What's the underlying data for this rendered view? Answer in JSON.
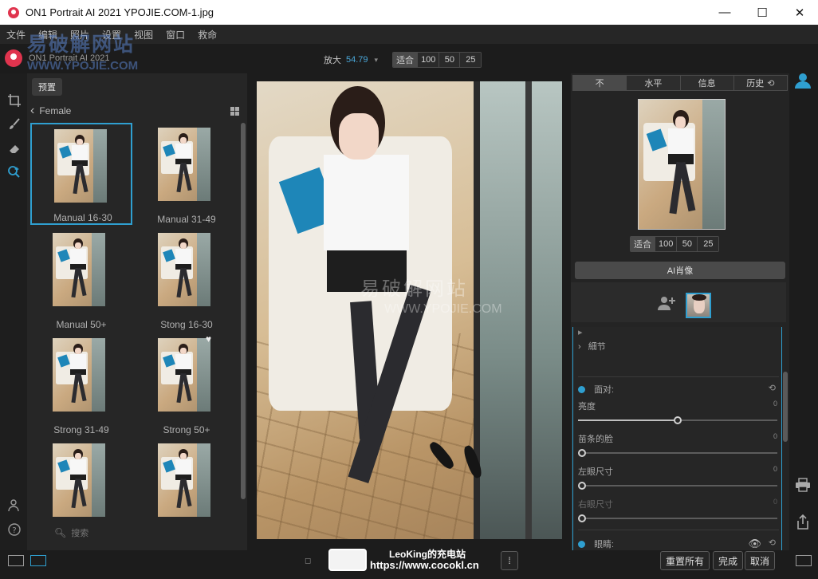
{
  "window": {
    "title": "ON1 Portrait AI 2021   YPOJIE.COM-1.jpg",
    "minimize": "—",
    "maximize": "☐",
    "close": "✕"
  },
  "menu": [
    "文件",
    "编辑",
    "照片",
    "设置",
    "视图",
    "窗口",
    "救命"
  ],
  "brand": {
    "name": "ON1 Portrait AI 2021",
    "watermark_cn": "易破解网站",
    "watermark_url": "WWW.YPOJIE.COM"
  },
  "zoom": {
    "label": "放大",
    "value": "54.79",
    "options": [
      "适合",
      "100",
      "50",
      "25"
    ],
    "selected": "适合"
  },
  "browser": {
    "preset_label": "预置",
    "breadcrumb": "Female",
    "search_placeholder": "搜索",
    "presets": [
      {
        "label": "Manual 16-30",
        "selected": true
      },
      {
        "label": "Manual 31-49"
      },
      {
        "label": "Manual 50+"
      },
      {
        "label": "Stong 16-30"
      },
      {
        "label": "Strong 31-49"
      },
      {
        "label": "Strong 50+"
      },
      {
        "label": ""
      },
      {
        "label": ""
      }
    ]
  },
  "canvas": {
    "watermark_cn": "易破解网站",
    "watermark_url": "WWW.YPOJIE.COM"
  },
  "right_panel": {
    "tabs": [
      "不",
      "水平",
      "信息",
      "历史"
    ],
    "zoom_options": [
      "适合",
      "100",
      "50",
      "25"
    ],
    "ai_button": "AI肖像",
    "adjustments": {
      "detail_label": "細节",
      "face_section": "面对:",
      "sliders": [
        {
          "label": "亮度",
          "value": "0",
          "level": 0.5
        },
        {
          "label": "苗条的脸",
          "value": "0",
          "level": 0.0
        },
        {
          "label": "左眼尺寸",
          "value": "0",
          "level": 0.0
        },
        {
          "label": "右眼尺寸",
          "value": "0",
          "level": 0.0
        }
      ],
      "eyes_section": "眼睛:"
    }
  },
  "bottom": {
    "reset_all": "重置所有",
    "done": "完成",
    "cancel": "取消",
    "overlay_line1": "LeoKing的充电站",
    "overlay_line2": "https://www.cocokl.cn"
  },
  "colors": {
    "accent": "#2f9fd0",
    "brand": "#e0344e",
    "panel": "#262626"
  }
}
